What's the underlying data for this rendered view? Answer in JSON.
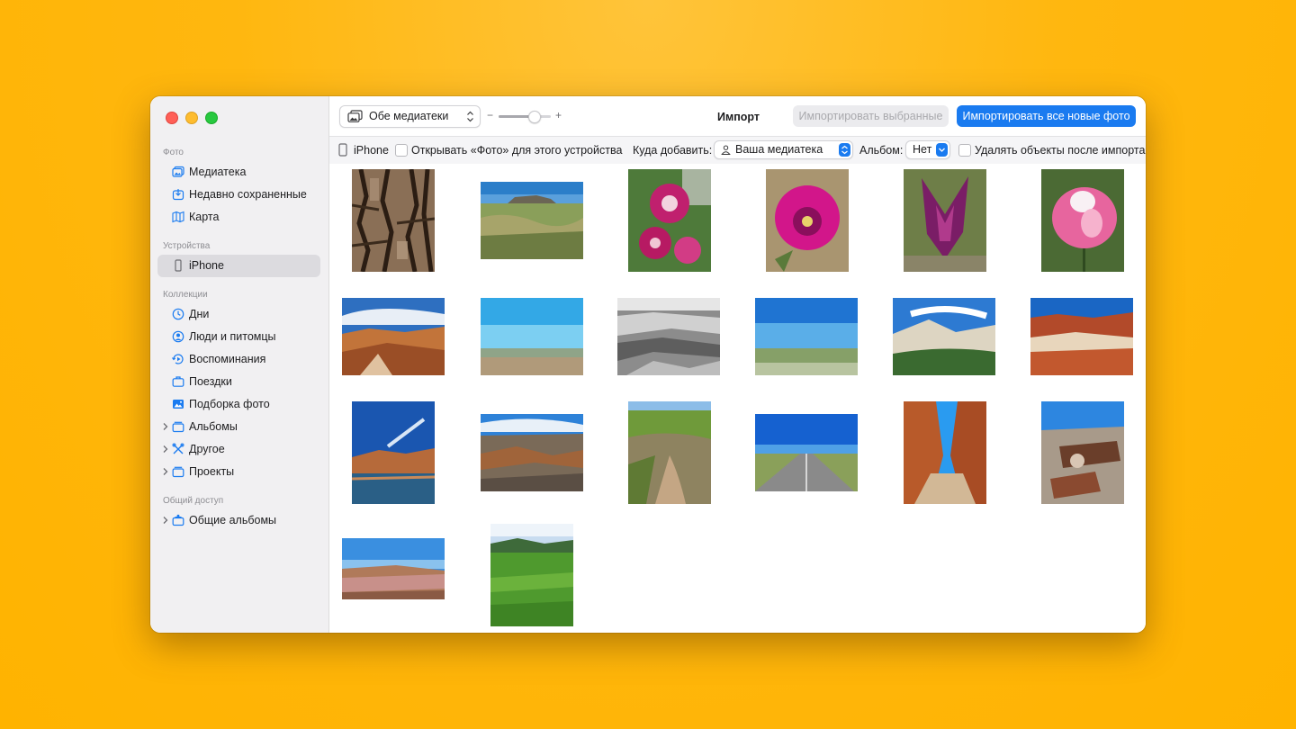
{
  "window": {
    "title": "Импорт"
  },
  "sidebar": {
    "sections": {
      "photos": "Фото",
      "devices": "Устройства",
      "collections": "Коллекции",
      "sharing": "Общий доступ"
    },
    "items": {
      "library": "Медиатека",
      "recently_saved": "Недавно сохраненные",
      "map": "Карта",
      "iphone": "iPhone",
      "days": "Дни",
      "people": "Люди и питомцы",
      "memories": "Воспоминания",
      "trips": "Поездки",
      "featured": "Подборка фото",
      "albums": "Альбомы",
      "other": "Другое",
      "projects": "Проекты",
      "shared_albums": "Общие альбомы"
    }
  },
  "toolbar": {
    "library_select": "Обе медиатеки",
    "zoom_minus": "−",
    "zoom_plus": "+",
    "import_selected": "Импортировать выбранные",
    "import_all": "Импортировать все новые фото"
  },
  "options": {
    "device": "iPhone",
    "open_photos": "Открывать «Фото» для этого устройства",
    "destination_label": "Куда добавить:",
    "destination_value": "Ваша медиатека",
    "album_label": "Альбом:",
    "album_value": "Нет",
    "delete_after": "Удалять объекты после импорта"
  },
  "colors": {
    "accent": "#1a7bf0",
    "background": "#ffb300"
  }
}
